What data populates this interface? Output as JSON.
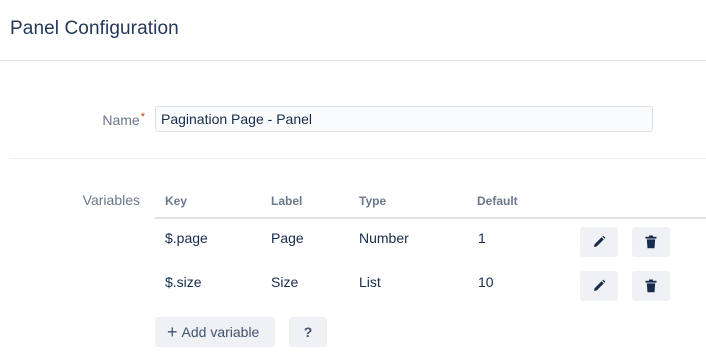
{
  "panel": {
    "title": "Panel Configuration"
  },
  "name_field": {
    "label": "Name",
    "required_mark": "*",
    "value": "Pagination Page - Panel"
  },
  "variables": {
    "label": "Variables",
    "columns": {
      "key": "Key",
      "label": "Label",
      "type": "Type",
      "default": "Default"
    },
    "rows": [
      {
        "key": "$.page",
        "label": "Page",
        "type": "Number",
        "default": "1"
      },
      {
        "key": "$.size",
        "label": "Size",
        "type": "List",
        "default": "10"
      }
    ],
    "row_actions": {
      "edit_icon": "pencil-icon",
      "delete_icon": "trash-icon"
    }
  },
  "actions": {
    "add_icon": "plus-icon",
    "add_label": "Add variable",
    "help_label": "?"
  }
}
